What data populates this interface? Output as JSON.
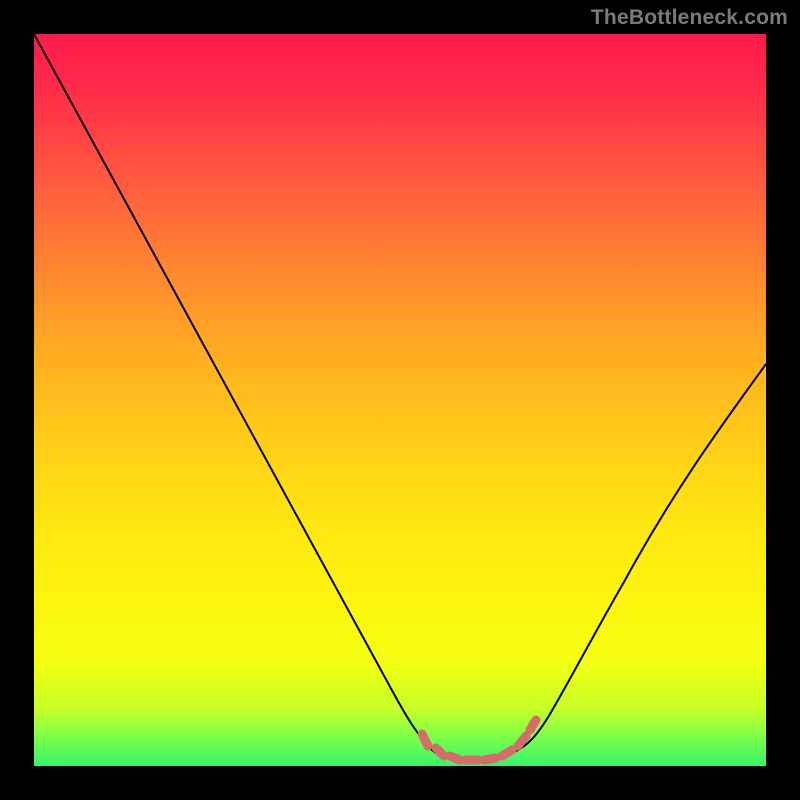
{
  "watermark": "TheBottleneck.com",
  "chart_data": {
    "type": "line",
    "title": "",
    "xlabel": "",
    "ylabel": "",
    "xlim": [
      0,
      100
    ],
    "ylim": [
      0,
      100
    ],
    "grid": false,
    "legend": false,
    "series": [
      {
        "name": "bottleneck-curve",
        "x": [
          0,
          6,
          12,
          18,
          24,
          30,
          36,
          42,
          48,
          54,
          56,
          58,
          60,
          62,
          64,
          66,
          68,
          72,
          78,
          84,
          90,
          96,
          100
        ],
        "y": [
          100,
          90,
          80,
          70,
          60,
          50,
          40,
          30,
          20,
          8,
          4,
          2,
          1,
          1,
          1,
          2,
          4,
          10,
          20,
          30,
          40,
          50,
          56
        ]
      },
      {
        "name": "optimal-band-markers",
        "x": [
          53,
          55,
          57,
          59,
          61,
          63,
          65,
          67
        ],
        "y": [
          4,
          2.5,
          1.5,
          1,
          1,
          1.5,
          2.5,
          4
        ]
      }
    ],
    "colors": {
      "curve": "#000000",
      "markers": "#d66b6b",
      "gradient_top": "#ff1a4b",
      "gradient_bottom": "#36f36b"
    }
  }
}
